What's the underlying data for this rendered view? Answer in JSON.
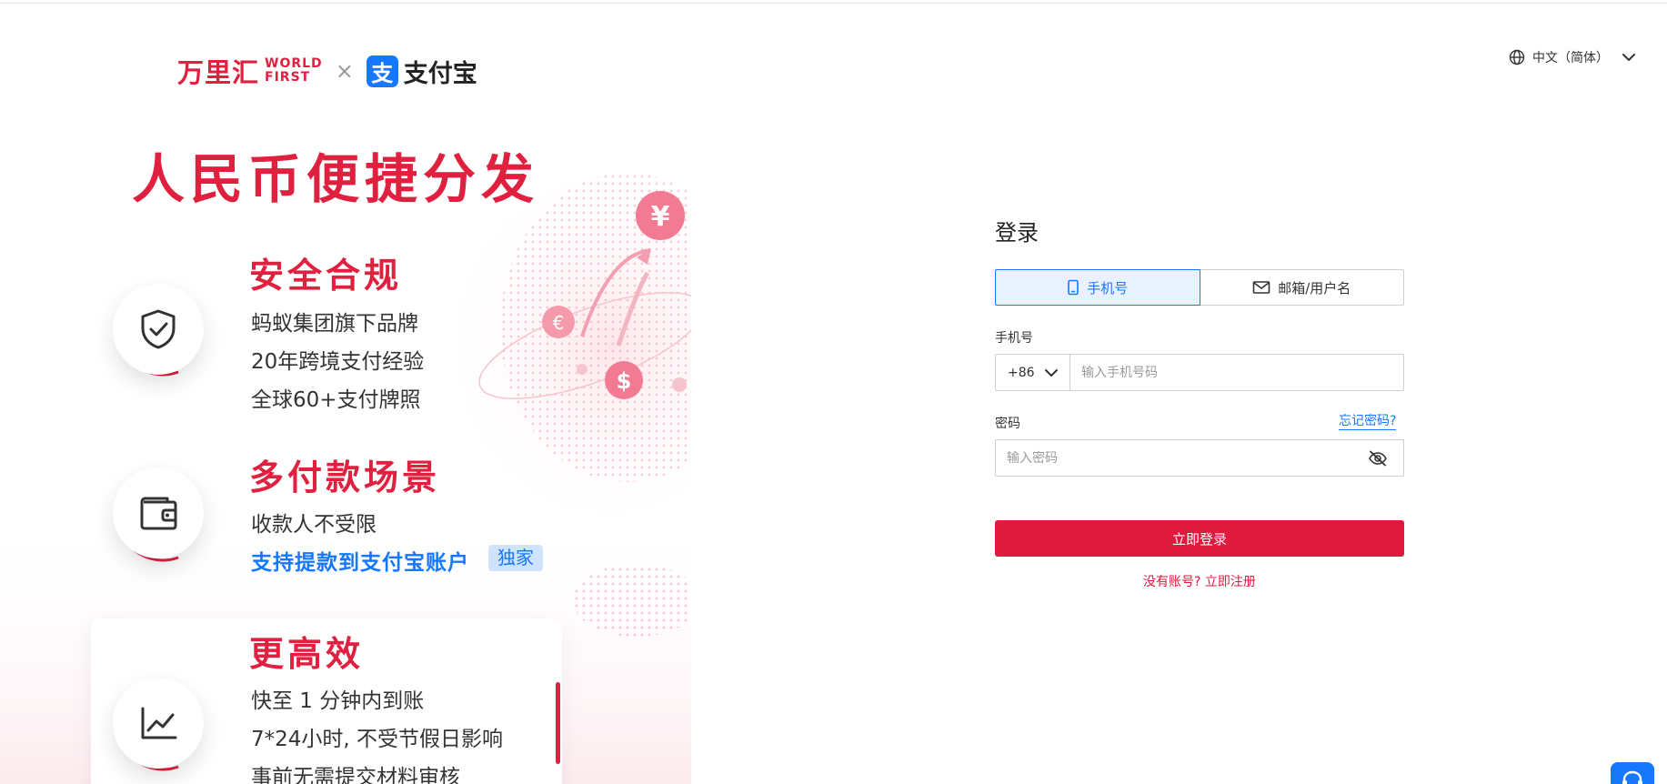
{
  "brand": {
    "wanlihui": "万里汇",
    "world_first_line1": "WORLD",
    "world_first_line2": "FIRST",
    "cross": "×",
    "alipay_glyph": "支",
    "alipay": "支付宝"
  },
  "hero": {
    "title": "人民币便捷分发"
  },
  "features": [
    {
      "title": "安全合规",
      "icon": "shield-check-icon",
      "lines": [
        "蚂蚁集团旗下品牌",
        "20年跨境支付经验",
        "全球60+支付牌照"
      ]
    },
    {
      "title": "多付款场景",
      "icon": "wallet-icon",
      "lines": [
        "收款人不受限",
        "支持提款到支付宝账户"
      ],
      "badge": "独家"
    },
    {
      "title": "更高效",
      "icon": "line-chart-icon",
      "lines": [
        "快至 1 分钟内到账",
        "7*24小时, 不受节假日影响",
        "事前无需提交材料审核"
      ]
    }
  ],
  "language": {
    "label": "中文（简体）",
    "icon": "globe-icon"
  },
  "login": {
    "title": "登录",
    "tabs": [
      {
        "label": "手机号",
        "icon": "phone-icon",
        "active": true
      },
      {
        "label": "邮箱/用户名",
        "icon": "mail-icon",
        "active": false
      }
    ],
    "phone_label": "手机号",
    "country_code": "+86",
    "phone_placeholder": "输入手机号码",
    "phone_value": "",
    "password_label": "密码",
    "forgot": "忘记密码?",
    "password_placeholder": "输入密码",
    "password_value": "",
    "submit": "立即登录",
    "register_text": "没有账号? 立即注册"
  },
  "colors": {
    "brand_red": "#e0203f",
    "alipay_blue": "#1677ff",
    "button_red": "#e01a3c"
  }
}
